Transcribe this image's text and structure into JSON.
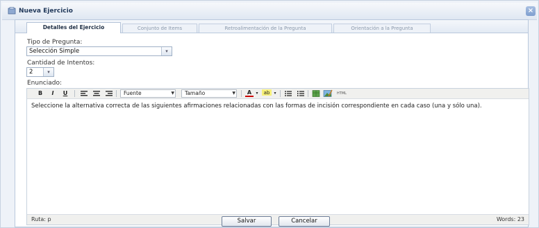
{
  "window": {
    "title": "Nueva Ejercicio",
    "close_glyph": "×"
  },
  "tabs": [
    {
      "label": "Detalles del Ejercicio",
      "active": true
    },
    {
      "label": "Conjunto de Items",
      "active": false
    },
    {
      "label": "Retroalimentación de la Pregunta",
      "active": false
    },
    {
      "label": "Orientación a la Pregunta",
      "active": false
    }
  ],
  "form": {
    "question_type_label": "Tipo de Pregunta:",
    "question_type_value": "Selección Simple",
    "attempts_label": "Cantidad de Intentos:",
    "attempts_value": "2",
    "statement_label": "Enunciado:"
  },
  "editor": {
    "font_combo": "Fuente",
    "size_combo": "Tamaño",
    "content": "Seleccione la  alternativa correcta de las siguientes afirmaciones relacionadas con las formas de incisión correspondiente en cada caso (una y sólo una).",
    "path": "Ruta: p",
    "word_count": "Words: 23",
    "html_label": "HTML",
    "buttons": {
      "bold": "B",
      "italic": "I",
      "underline": "U",
      "font_color_icon": "A",
      "highlight_icon": "ab"
    },
    "icons": [
      "align-left-icon",
      "align-center-icon",
      "align-right-icon",
      "font-color-icon",
      "highlight-icon",
      "bullet-list-icon",
      "numbered-list-icon",
      "table-icon",
      "image-icon"
    ]
  },
  "footer": {
    "save_label": "Salvar",
    "cancel_label": "Cancelar"
  }
}
